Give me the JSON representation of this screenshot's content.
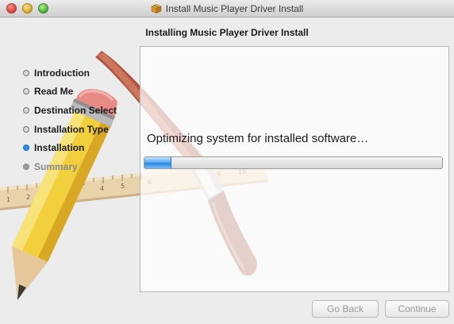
{
  "window": {
    "title": "Install Music Player Driver Install",
    "title_icon": "package-icon"
  },
  "header": {
    "title": "Installing Music Player Driver Install"
  },
  "sidebar": {
    "steps": [
      {
        "label": "Introduction",
        "state": "done"
      },
      {
        "label": "Read Me",
        "state": "done"
      },
      {
        "label": "Destination Select",
        "state": "done"
      },
      {
        "label": "Installation Type",
        "state": "done"
      },
      {
        "label": "Installation",
        "state": "current"
      },
      {
        "label": "Summary",
        "state": "pending"
      }
    ]
  },
  "main": {
    "status_text": "Optimizing system for installed software…",
    "progress_fraction": 0.09
  },
  "buttons": {
    "back_label": "Go Back",
    "continue_label": "Continue"
  },
  "colors": {
    "accent": "#2f8fe6",
    "window_bg": "#ececec"
  }
}
